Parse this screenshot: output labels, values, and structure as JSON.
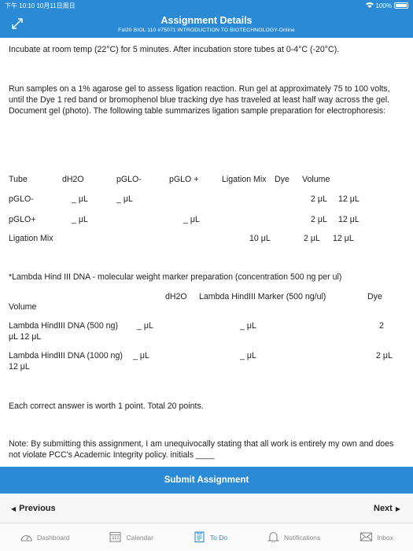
{
  "status": {
    "time": "下午 10:10  10月11日周日",
    "battery": "100%"
  },
  "header": {
    "title": "Assignment Details",
    "subtitle": "Fal20 BIOL 110 #75071 INTRODUCTION TO BIOTECHNOLOGY-Online"
  },
  "body": {
    "p1": "Incubate at room temp (22°C) for 5 minutes.  After incubation store tubes at 0-4°C (-20°C).",
    "p2": "Run samples on a 1% agarose gel to assess ligation reaction.  Run gel at approximately 75 to 100 volts, until the Dye 1 red band or bromophenol blue tracking dye has traveled at least half way across the gel.  Document gel (photo).  The following table summarizes ligation sample preparation for electrophoresis:",
    "table1": {
      "headers": [
        "Tube",
        "dH2O",
        "pGLO-",
        "pGLO +",
        "Ligation Mix",
        "Dye",
        "Volume"
      ],
      "row1": [
        "pGLO-",
        "_ μL",
        "_ μL",
        "2 μL",
        "12 μL"
      ],
      "row2": [
        "pGLO+",
        "_ μL",
        "_ μL",
        "2 μL",
        "12 μL"
      ],
      "row3": [
        "Ligation Mix",
        "10 μL",
        "2 μL",
        "12 μL"
      ]
    },
    "lambda_title": "*Lambda Hind III DNA - molecular weight marker preparation (concentration 500 ng per ul)",
    "table2": {
      "headers": [
        "dH2O",
        "Lambda HindIII Marker (500 ng/ul)",
        "Dye"
      ],
      "volume": "Volume",
      "row1": [
        "Lambda HindIII DNA (500 ng)",
        "_ μL",
        "_ μL",
        "2",
        "μL   12 μL"
      ],
      "row2": [
        "Lambda HindIII DNA (1000 ng)",
        "_ μL",
        "_ μL",
        "2 μL",
        "12 μL"
      ]
    },
    "points": "Each correct answer is worth 1 point. Total 20 points.",
    "note": "Note: By submitting this assignment, I am unequivocally stating that all work is entirely my own and does not violate PCC's Academic Integrity policy.   initials ____"
  },
  "submit_label": "Submit Assignment",
  "pager": {
    "previous": "Previous",
    "next": "Next"
  },
  "tabs": [
    {
      "label": "Dashboard",
      "icon": "dashboard-icon"
    },
    {
      "label": "Calendar",
      "icon": "calendar-icon"
    },
    {
      "label": "To Do",
      "icon": "todo-icon"
    },
    {
      "label": "Notifications",
      "icon": "bell-icon"
    },
    {
      "label": "Inbox",
      "icon": "inbox-icon"
    }
  ],
  "colors": {
    "accent": "#2a8ad6"
  }
}
